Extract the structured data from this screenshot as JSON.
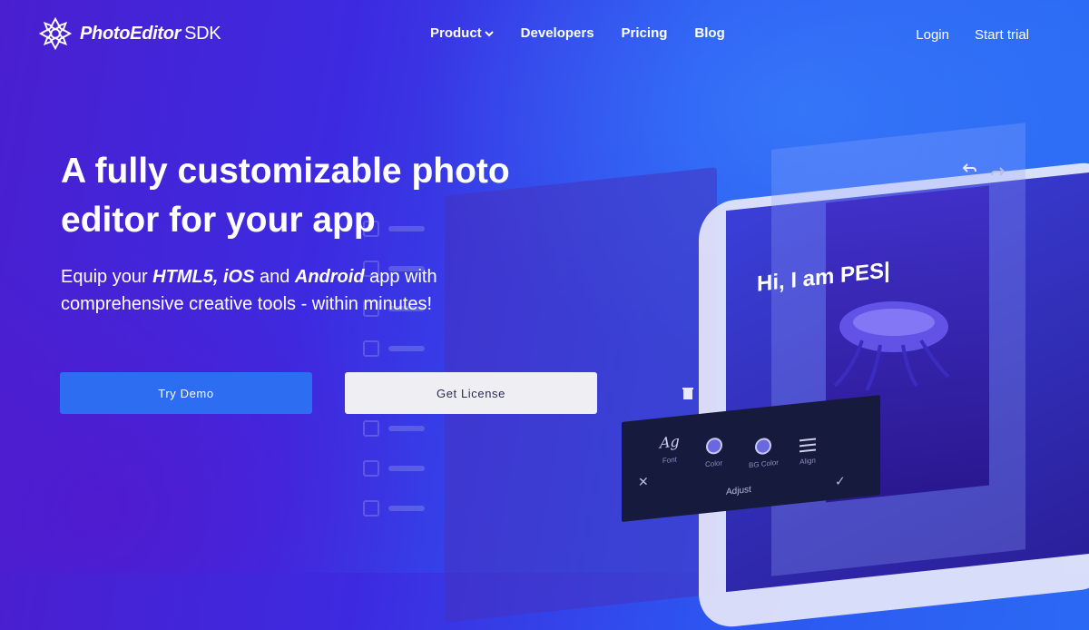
{
  "brand": {
    "name": "PhotoEditor",
    "suffix": "SDK"
  },
  "nav": {
    "items": [
      {
        "label": "Product",
        "has_dropdown": true
      },
      {
        "label": "Developers",
        "has_dropdown": false
      },
      {
        "label": "Pricing",
        "has_dropdown": false
      },
      {
        "label": "Blog",
        "has_dropdown": false
      }
    ],
    "login_label": "Login",
    "trial_label": "Start trial"
  },
  "hero": {
    "title": "A fully customizable photo editor for your app",
    "subtitle_parts": {
      "pre": "Equip your ",
      "html5": "HTML5,",
      "mid1": " ",
      "ios": "iOS",
      "mid2": " and ",
      "android": "Android",
      "post": " app with comprehensive creative tools - within minutes!"
    },
    "demo_button": "Try Demo",
    "license_button": "Get License"
  },
  "mockup": {
    "overlay_text": "Hi, I am PES|",
    "tools": [
      {
        "label": "Font",
        "icon": "font-ag-icon",
        "glyph": "Ag"
      },
      {
        "label": "Color",
        "icon": "color-swatch-icon"
      },
      {
        "label": "BG Color",
        "icon": "bg-color-swatch-icon"
      },
      {
        "label": "Align",
        "icon": "align-icon"
      }
    ],
    "adjust_label": "Adjust",
    "close_glyph": "✕",
    "check_glyph": "✓"
  },
  "colors": {
    "bg_left": "#4a1fd0",
    "bg_right": "#2a6ef5",
    "accent_button": "#2d6df2",
    "secondary_button": "#efeff3",
    "toolbar": "#161a3c"
  }
}
